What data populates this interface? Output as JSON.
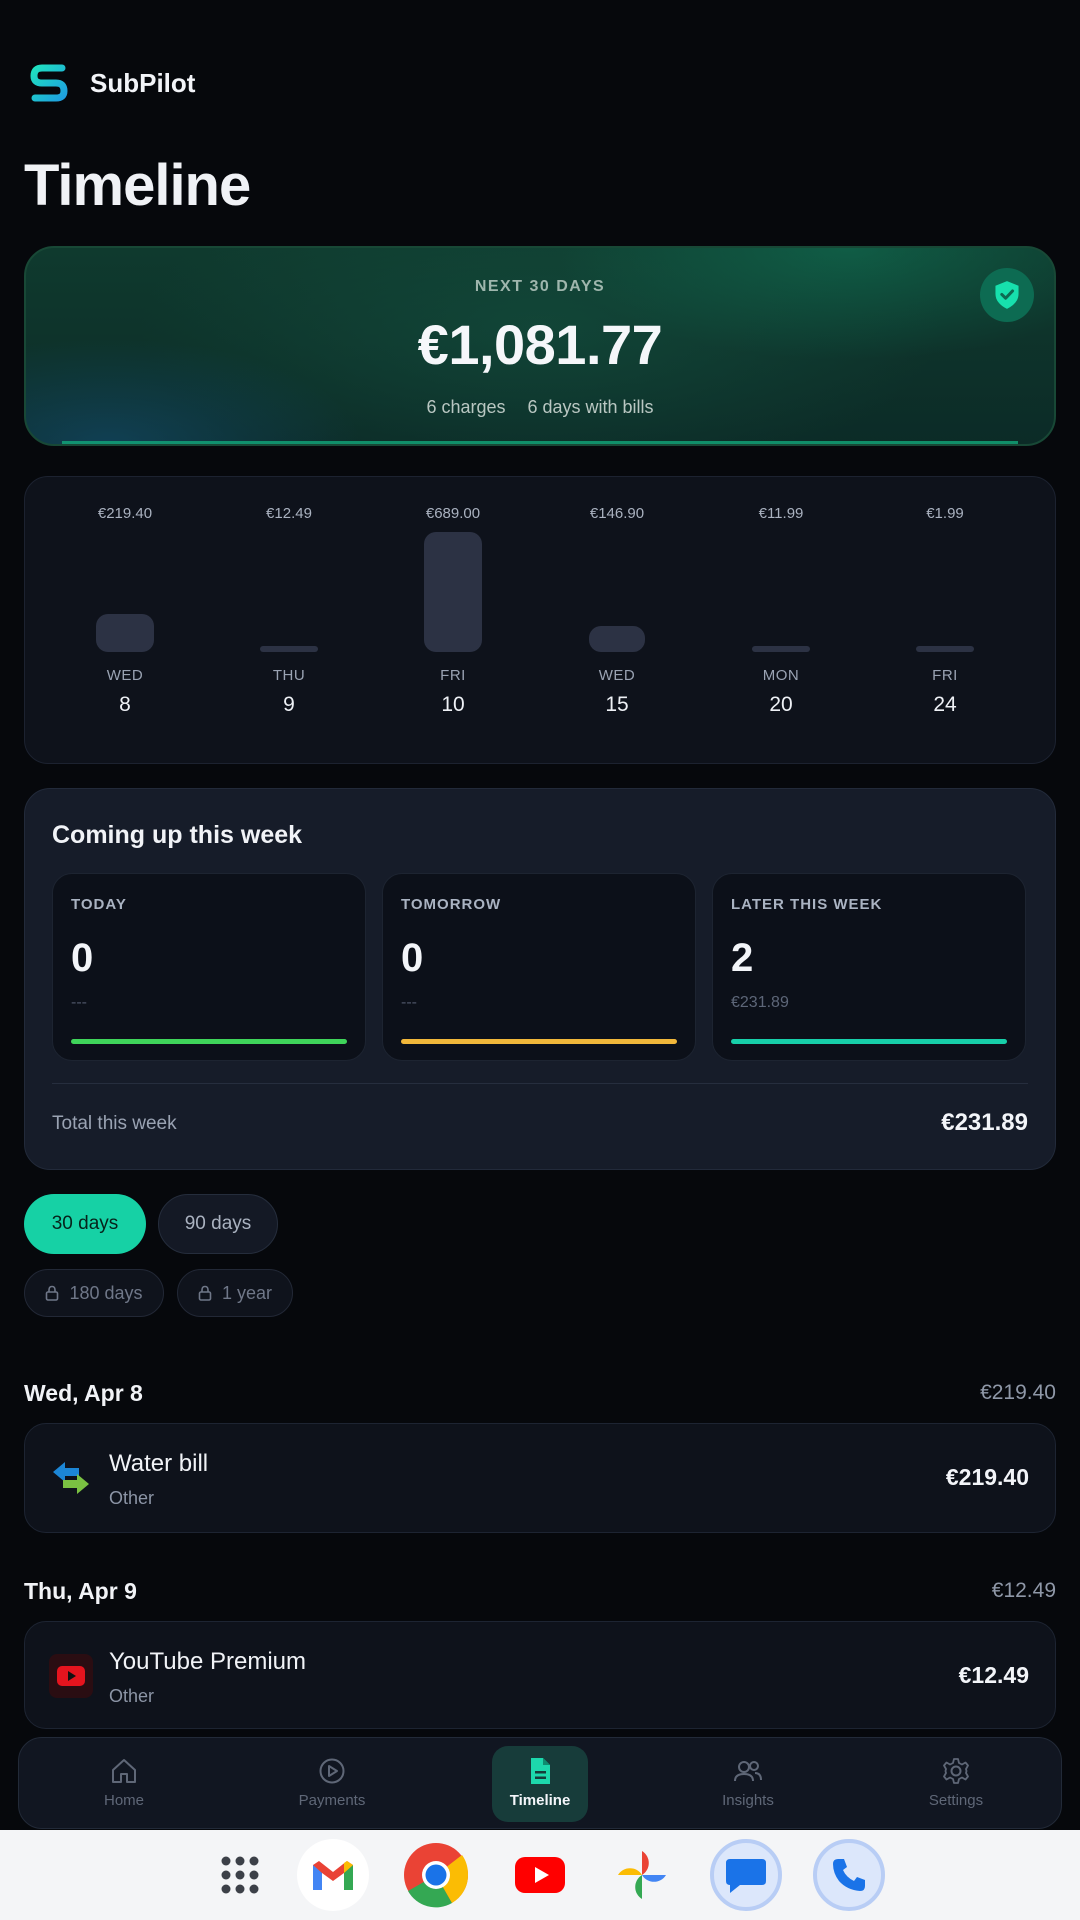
{
  "app": {
    "name": "SubPilot"
  },
  "page": {
    "title": "Timeline"
  },
  "hero": {
    "label": "NEXT 30 DAYS",
    "amount": "€1,081.77",
    "charges": "6 charges",
    "bill_days": "6 days with bills",
    "badge_icon": "shield-check-icon"
  },
  "bar_chart": {
    "bars": [
      {
        "amount": "€219.40",
        "value": 219.4,
        "weekday": "WED",
        "day": "8"
      },
      {
        "amount": "€12.49",
        "value": 12.49,
        "weekday": "THU",
        "day": "9"
      },
      {
        "amount": "€689.00",
        "value": 689.0,
        "weekday": "FRI",
        "day": "10"
      },
      {
        "amount": "€146.90",
        "value": 146.9,
        "weekday": "WED",
        "day": "15"
      },
      {
        "amount": "€11.99",
        "value": 11.99,
        "weekday": "MON",
        "day": "20"
      },
      {
        "amount": "€1.99",
        "value": 1.99,
        "weekday": "FRI",
        "day": "24"
      }
    ]
  },
  "week": {
    "title": "Coming up this week",
    "tiles": [
      {
        "label": "TODAY",
        "count": "0",
        "sub": "---",
        "color": "#3fd45a"
      },
      {
        "label": "TOMORROW",
        "count": "0",
        "sub": "---",
        "color": "#f1b73a"
      },
      {
        "label": "LATER THIS WEEK",
        "count": "2",
        "sub": "€231.89",
        "color": "#17cfa9"
      }
    ],
    "total_label": "Total this week",
    "total_value": "€231.89"
  },
  "ranges": {
    "active": "30 days",
    "option_90": "90 days",
    "locked_180": "180 days",
    "locked_year": "1 year"
  },
  "groups": [
    {
      "date": "Wed, Apr 8",
      "total": "€219.40",
      "bill": {
        "name": "Water bill",
        "category": "Other",
        "amount": "€219.40"
      }
    },
    {
      "date": "Thu, Apr 9",
      "total": "€12.49",
      "bill": {
        "name": "YouTube Premium",
        "category": "Other",
        "amount": "€12.49"
      }
    }
  ],
  "nav": {
    "home": "Home",
    "payments": "Payments",
    "timeline": "Timeline",
    "insights": "Insights",
    "settings": "Settings"
  },
  "colors": {
    "accent": "#16d1a5",
    "background": "#06080c",
    "card": "#0e121b"
  }
}
